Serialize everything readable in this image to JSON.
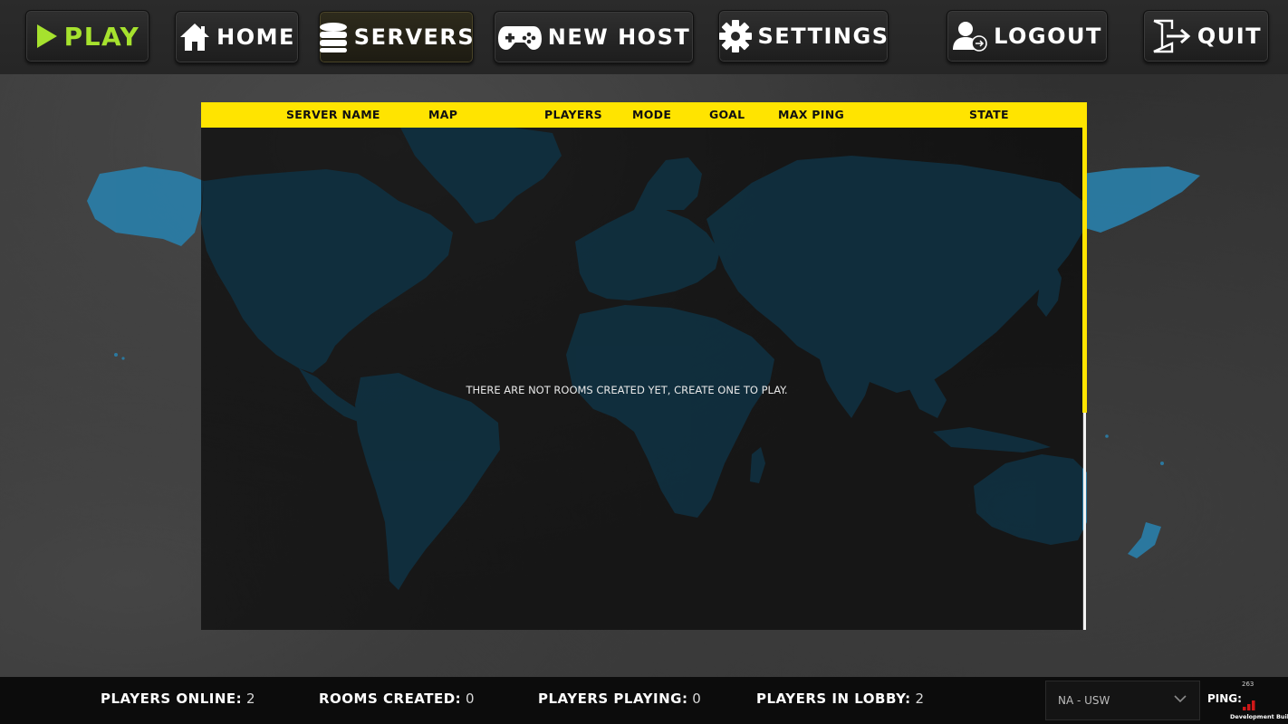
{
  "nav": {
    "play": "PLAY",
    "home": "HOME",
    "servers": "SERVERS",
    "new_host": "NEW HOST",
    "settings": "SETTINGS",
    "logout": "LOGOUT",
    "quit": "QUIT"
  },
  "server_list": {
    "columns": [
      "SERVER NAME",
      "MAP",
      "PLAYERS",
      "MODE",
      "GOAL",
      "MAX PING",
      "STATE"
    ],
    "rows": [],
    "empty_message": "THERE ARE NOT ROOMS CREATED YET, CREATE ONE TO PLAY."
  },
  "stats": {
    "players_online_label": "PLAYERS ONLINE:",
    "players_online": "2",
    "rooms_created_label": "ROOMS CREATED:",
    "rooms_created": "0",
    "players_playing_label": "PLAYERS PLAYING:",
    "players_playing": "0",
    "players_in_lobby_label": "PLAYERS IN LOBBY:",
    "players_in_lobby": "2"
  },
  "region": {
    "selected": "NA - USW"
  },
  "ping": {
    "label": "PING:",
    "value": "263"
  },
  "build_label": "Development Build",
  "colors": {
    "accent_yellow": "#ffe400",
    "play_green": "#a6e22e",
    "map_blue": "#2a7ea8",
    "ping_red": "#d01818"
  },
  "icons": {
    "play": "play-triangle-icon",
    "home": "house-icon",
    "servers": "database-stack-icon",
    "new_host": "gamepad-icon",
    "settings": "gear-icon",
    "logout": "user-logout-icon",
    "quit": "exit-door-icon"
  }
}
